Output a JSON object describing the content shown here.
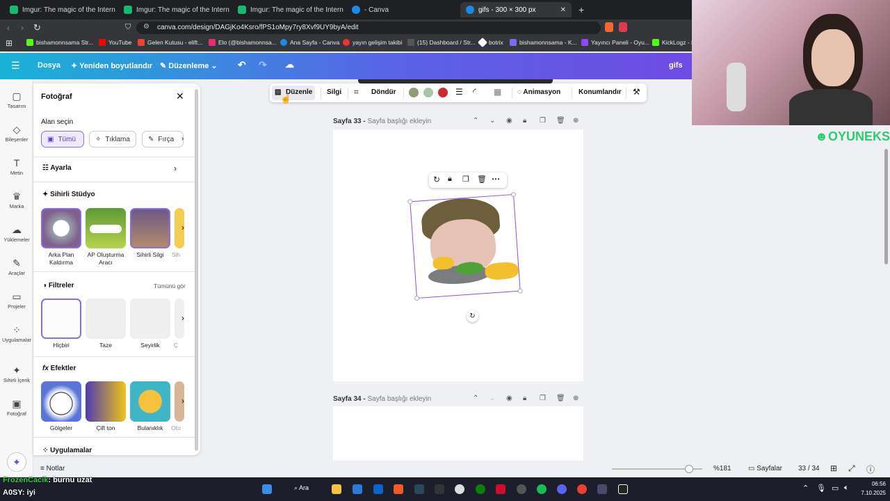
{
  "browser": {
    "tabs": [
      {
        "title": "Imgur: The magic of the Internet",
        "color": "#1bb76e"
      },
      {
        "title": "Imgur: The magic of the Internet",
        "color": "#1bb76e"
      },
      {
        "title": "Imgur: The magic of the Internet",
        "color": "#1bb76e"
      },
      {
        "title": "- Canva",
        "color": "#1e88e5"
      },
      {
        "title": "gifs - 300 × 300 px",
        "color": "#1e88e5"
      }
    ],
    "url": "canva.com/design/DAGjKo4Ksro/fPS1oMpy7ry8Xvf9UY9byA/edit",
    "bookmarks": [
      {
        "label": "bishamonnsama Str...",
        "color": "#53fc18"
      },
      {
        "label": "YouTube",
        "color": "#ff0000"
      },
      {
        "label": "Gelen Kutusu - elift...",
        "color": "#ea4335"
      },
      {
        "label": "Elo (@bishamonnsa...",
        "color": "#e1306c"
      },
      {
        "label": "Ana Sayfa - Canva",
        "color": "#1e88e5"
      },
      {
        "label": "yayın gelişim takibi",
        "color": "#e33"
      },
      {
        "label": "(15) Dashboard / Str...",
        "color": "#555"
      },
      {
        "label": "botrix",
        "color": "#fff"
      },
      {
        "label": "bishamonnsama - K...",
        "color": "#7a6cf0"
      },
      {
        "label": "Yayıncı Paneli - Oyu...",
        "color": "#9146ff"
      },
      {
        "label": "KickLogz - K",
        "color": "#53fc18"
      }
    ]
  },
  "header": {
    "file": "Dosya",
    "resize": "Yeniden boyutlandır",
    "edit": "Düzenleme",
    "title": "gifs"
  },
  "rail": [
    {
      "label": "Tasarım",
      "icon": "layout-icon",
      "glyph": "▢"
    },
    {
      "label": "Bileşenler",
      "icon": "elements-icon",
      "glyph": "◇"
    },
    {
      "label": "Metin",
      "icon": "text-icon",
      "glyph": "T"
    },
    {
      "label": "Marka",
      "icon": "brand-icon",
      "glyph": "♛"
    },
    {
      "label": "Yüklemeler",
      "icon": "upload-icon",
      "glyph": "☁"
    },
    {
      "label": "Araçlar",
      "icon": "tools-icon",
      "glyph": "✎"
    },
    {
      "label": "Projeler",
      "icon": "folder-icon",
      "glyph": "▭"
    },
    {
      "label": "Uygulamalar",
      "icon": "apps-icon",
      "glyph": "⁘"
    },
    {
      "label": "Sihirli İçerik",
      "icon": "magic-media-icon",
      "glyph": "✦"
    },
    {
      "label": "Fotoğraf",
      "icon": "photo-icon",
      "glyph": "▣"
    }
  ],
  "panel": {
    "title": "Fotoğraf",
    "select_area": "Alan seçin",
    "chips": [
      "Tümü",
      "Tıklama",
      "Fırça"
    ],
    "adjust": "Ayarla",
    "magic_studio": "Sihirli Stüdyo",
    "magic_items": [
      "Arka Plan Kaldırma",
      "AP Oluşturma Aracı",
      "Sihirli Silgi",
      "Sih"
    ],
    "filters": "Filtreler",
    "see_all": "Tümünü gör",
    "filter_items": [
      "Hiçbiri",
      "Taze",
      "Seyirlik",
      "Ç"
    ],
    "effects": "Efektler",
    "effect_items": [
      "Gölgeler",
      "Çift ton",
      "Bulanıklık",
      "Oto"
    ],
    "apps": "Uygulamalar"
  },
  "toolbar": {
    "edit": "Düzenle",
    "erase": "Silgi",
    "rotate": "Döndür",
    "animate": "Animasyon",
    "position": "Konumlandır",
    "colors": [
      "#8e9c7a",
      "#a8c4a8",
      "#cc2b2b"
    ]
  },
  "pages": {
    "p33_label": "Sayfa 33 -",
    "p33_hint": "Sayfa başlığı ekleyin",
    "p34_label": "Sayfa 34 -",
    "p34_hint": "Sayfa başlığı ekleyin"
  },
  "bottom": {
    "notes": "Notlar",
    "zoom": "%181",
    "zoom_level": 0.85,
    "pages": "Sayfalar",
    "page_count": "33 / 34"
  },
  "taskbar": {
    "search": "Ara",
    "time": "06:56",
    "date": "7.10.2025"
  },
  "overlay": {
    "chat1_user": "FrozenCacik",
    "chat1_msg": ": burnu uzat",
    "chat2_user": "A0SY",
    "chat2_msg": ": iyi",
    "brand": "OYUNEKS"
  }
}
